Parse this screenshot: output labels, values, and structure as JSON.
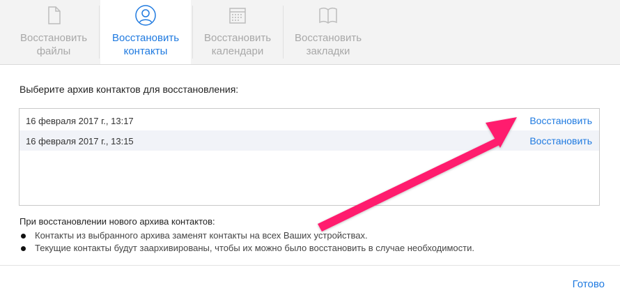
{
  "toolbar": {
    "tabs": [
      {
        "line1": "Восстановить",
        "line2": "файлы",
        "icon": "document-icon"
      },
      {
        "line1": "Восстановить",
        "line2": "контакты",
        "icon": "contact-person-icon"
      },
      {
        "line1": "Восстановить",
        "line2": "календари",
        "icon": "calendar-icon"
      },
      {
        "line1": "Восстановить",
        "line2": "закладки",
        "icon": "book-icon"
      }
    ],
    "active_tab": 1
  },
  "main": {
    "heading": "Выберите архив контактов для восстановления:",
    "archives": [
      {
        "date": "16 февраля 2017 г., 13:17",
        "action": "Восстановить"
      },
      {
        "date": "16 февраля 2017 г., 13:15",
        "action": "Восстановить"
      }
    ],
    "info_title": "При восстановлении нового архива контактов:",
    "bullets": [
      "Контакты из выбранного архива заменят контакты на всех Ваших устройствах.",
      "Текущие контакты будут заархивированы, чтобы их можно было восстановить в случае необходимости."
    ]
  },
  "footer": {
    "done_label": "Готово"
  },
  "colors": {
    "accent": "#1f7ae0",
    "annotation_arrow": "#ff1f6e"
  }
}
